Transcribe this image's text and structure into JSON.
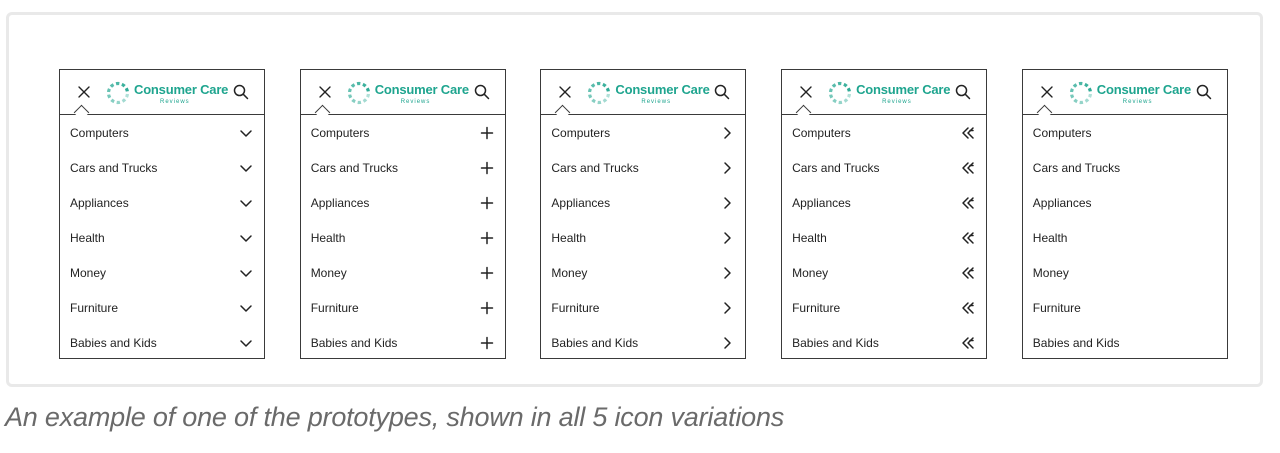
{
  "brand": {
    "name": "Consumer Care",
    "sub": "Reviews"
  },
  "colors": {
    "accent": "#1fa58f",
    "border": "#3a3a3a",
    "frame": "#e9e9e9"
  },
  "menu_items": [
    "Computers",
    "Cars and Trucks",
    "Appliances",
    "Health",
    "Money",
    "Furniture",
    "Babies and Kids"
  ],
  "variants": [
    {
      "icon": "chevron-down-icon"
    },
    {
      "icon": "plus-icon"
    },
    {
      "icon": "chevron-right-icon"
    },
    {
      "icon": "double-chevron-left-icon"
    },
    {
      "icon": "none"
    }
  ],
  "header_icons": {
    "left": "close-icon",
    "right": "search-icon"
  },
  "caption": "An example of one of the prototypes, shown in all 5 icon variations"
}
